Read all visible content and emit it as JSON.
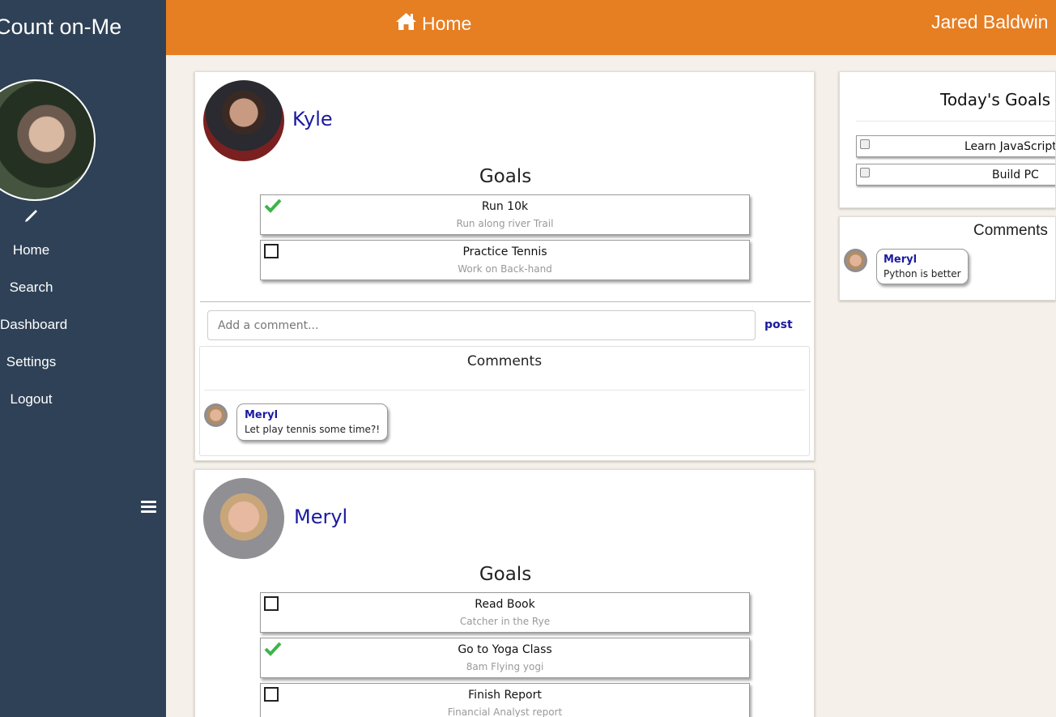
{
  "sidebar": {
    "brand": "Count on-Me",
    "nav": [
      {
        "label": "Home"
      },
      {
        "label": "Search"
      },
      {
        "label": "Dashboard"
      },
      {
        "label": "Settings"
      },
      {
        "label": "Logout"
      }
    ]
  },
  "topbar": {
    "title": "Home",
    "user": "Jared Baldwin"
  },
  "feed": [
    {
      "name": "Kyle",
      "goals_title": "Goals",
      "goals": [
        {
          "title": "Run 10k",
          "subtitle": "Run along river Trail",
          "done": true
        },
        {
          "title": "Practice Tennis",
          "subtitle": "Work on Back-hand",
          "done": false
        }
      ],
      "comment_placeholder": "Add a comment...",
      "post_label": "post",
      "comments_title": "Comments",
      "comments": [
        {
          "author": "Meryl",
          "text": "Let play tennis some time?!"
        }
      ]
    },
    {
      "name": "Meryl",
      "goals_title": "Goals",
      "goals": [
        {
          "title": "Read Book",
          "subtitle": "Catcher in the Rye",
          "done": false
        },
        {
          "title": "Go to Yoga Class",
          "subtitle": "8am Flying yogi",
          "done": true
        },
        {
          "title": "Finish Report",
          "subtitle": "Financial Analyst report",
          "done": false
        }
      ]
    }
  ],
  "today": {
    "title": "Today's Goals",
    "goals": [
      {
        "label": "Learn JavaScript"
      },
      {
        "label": "Build PC"
      }
    ]
  },
  "right_comments": {
    "title": "Comments",
    "items": [
      {
        "author": "Meryl",
        "text": "Python is better"
      }
    ]
  },
  "colors": {
    "sidebar": "#2f4156",
    "topbar": "#e67e22",
    "accent_name": "#1a1aa0",
    "check": "#3cb54a"
  }
}
